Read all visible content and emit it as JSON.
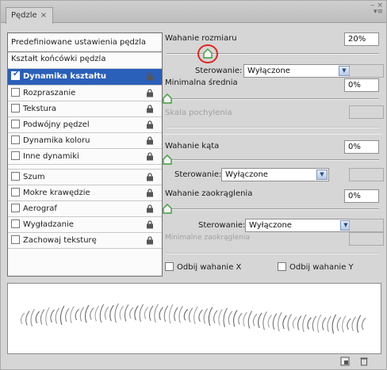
{
  "tab": {
    "title": "Pędzle",
    "close": "×"
  },
  "window_controls": {
    "min": "‒ ×",
    "menu": "▾≡"
  },
  "left": {
    "preset_button": "Predefiniowane ustawienia pędzla",
    "tip_shape": "Kształt końcówki pędzla",
    "items": [
      {
        "label": "Dynamika kształtu",
        "checked": true,
        "selected": true
      },
      {
        "label": "Rozpraszanie",
        "checked": false
      },
      {
        "label": "Tekstura",
        "checked": false
      },
      {
        "label": "Podwójny pędzel",
        "checked": false
      },
      {
        "label": "Dynamika koloru",
        "checked": false
      },
      {
        "label": "Inne dynamiki",
        "checked": false
      },
      {
        "label": "Szum",
        "checked": false
      },
      {
        "label": "Mokre krawędzie",
        "checked": false
      },
      {
        "label": "Aerograf",
        "checked": false
      },
      {
        "label": "Wygładzanie",
        "checked": false
      },
      {
        "label": "Zachowaj teksturę",
        "checked": false
      }
    ]
  },
  "settings": {
    "size_jitter": {
      "label": "Wahanie rozmiaru",
      "value": "20%",
      "slider_fraction": 0.2
    },
    "control_1": {
      "label": "Sterowanie:",
      "value": "Wyłączone"
    },
    "min_diameter": {
      "label": "Minimalna średnia",
      "value": "0%"
    },
    "tilt_scale": {
      "label": "Skala pochylenia"
    },
    "angle_jitter": {
      "label": "Wahanie kąta",
      "value": "0%"
    },
    "control_2": {
      "label": "Sterowanie:",
      "value": "Wyłączone"
    },
    "roundness_jitter": {
      "label": "Wahanie zaokrąglenia",
      "value": "0%"
    },
    "control_3": {
      "label": "Sterowanie:",
      "value": "Wyłączone"
    },
    "min_roundness": {
      "label": "Minimalne zaokrąglenia"
    },
    "flip_x": {
      "label": "Odbij wahanie X",
      "checked": false
    },
    "flip_y": {
      "label": "Odbij wahanie Y",
      "checked": false
    }
  },
  "icons": {
    "lock": "lock-icon",
    "new_brush": "new-brush-icon",
    "trash": "trash-icon"
  },
  "colors": {
    "selection": "#2a5fba",
    "highlight_ring": "#e0251f"
  }
}
